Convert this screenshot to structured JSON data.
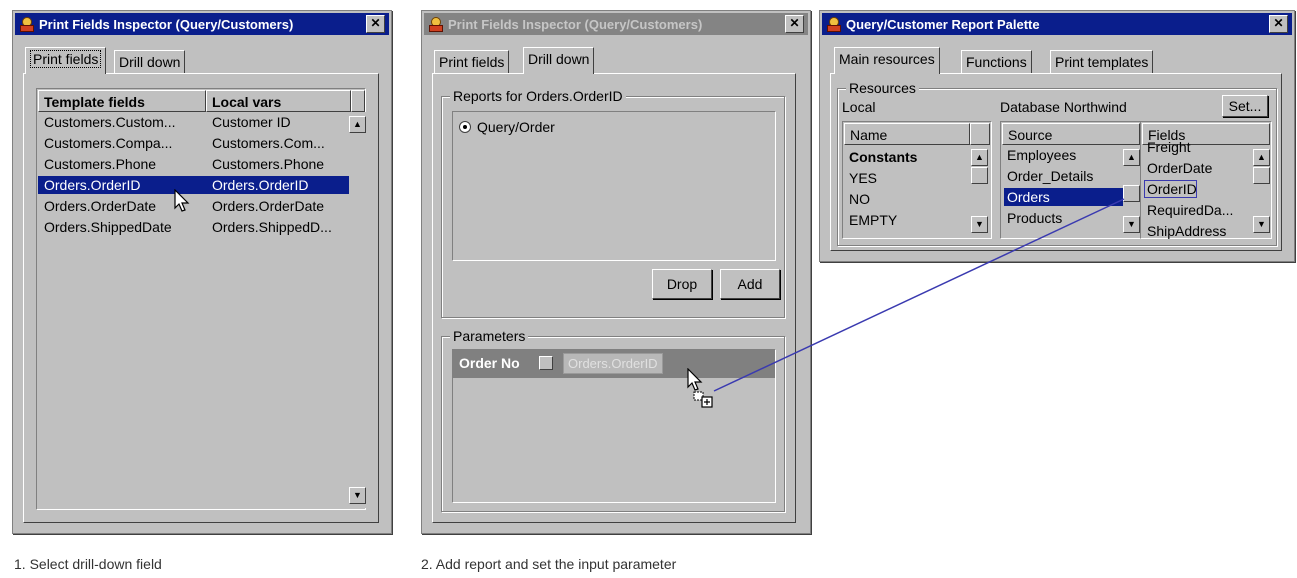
{
  "window1": {
    "title": "Print Fields Inspector (Query/Customers)",
    "close": "✕",
    "tabs": [
      "Print fields",
      "Drill down"
    ],
    "columns": [
      "Template fields",
      "Local vars"
    ],
    "rows": [
      [
        "Customers.Custom...",
        "Customer ID"
      ],
      [
        "Customers.Compa...",
        "Customers.Com..."
      ],
      [
        "Customers.Phone",
        "Customers.Phone"
      ],
      [
        "Orders.OrderID",
        "Orders.OrderID"
      ],
      [
        "Orders.OrderDate",
        "Orders.OrderDate"
      ],
      [
        "Orders.ShippedDate",
        "Orders.ShippedD..."
      ]
    ],
    "selected_row": 3
  },
  "window2": {
    "title": "Print Fields Inspector (Query/Customers)",
    "close": "✕",
    "tabs": [
      "Print fields",
      "Drill down"
    ],
    "reports_group": "Reports for Orders.OrderID",
    "reports": [
      "Query/Order"
    ],
    "drop_label": "Drop",
    "add_label": "Add",
    "params_group": "Parameters",
    "param_name": "Order No",
    "param_value": "Orders.OrderID"
  },
  "window3": {
    "title": "Query/Customer Report Palette",
    "close": "✕",
    "tabs": [
      "Main resources",
      "Functions",
      "Print templates"
    ],
    "resources_group": "Resources",
    "local_label": "Local",
    "db_label": "Database Northwind",
    "set_label": "Set...",
    "name_header": "Name",
    "local_items": [
      "Constants",
      "YES",
      "NO",
      "EMPTY"
    ],
    "source_header": "Source",
    "sources": [
      "Employees",
      "Order_Details",
      "Orders",
      "Products"
    ],
    "fields_header": "Fields",
    "fields": [
      "Freight",
      "OrderDate",
      "OrderID",
      "RequiredDa...",
      "ShipAddress"
    ]
  },
  "captions": {
    "step1": "1.  Select drill-down field",
    "step2": "2.  Add report and set the input parameter"
  },
  "colors": {
    "selection": "#0a1e8c",
    "link_line": "#3a3ab0"
  }
}
